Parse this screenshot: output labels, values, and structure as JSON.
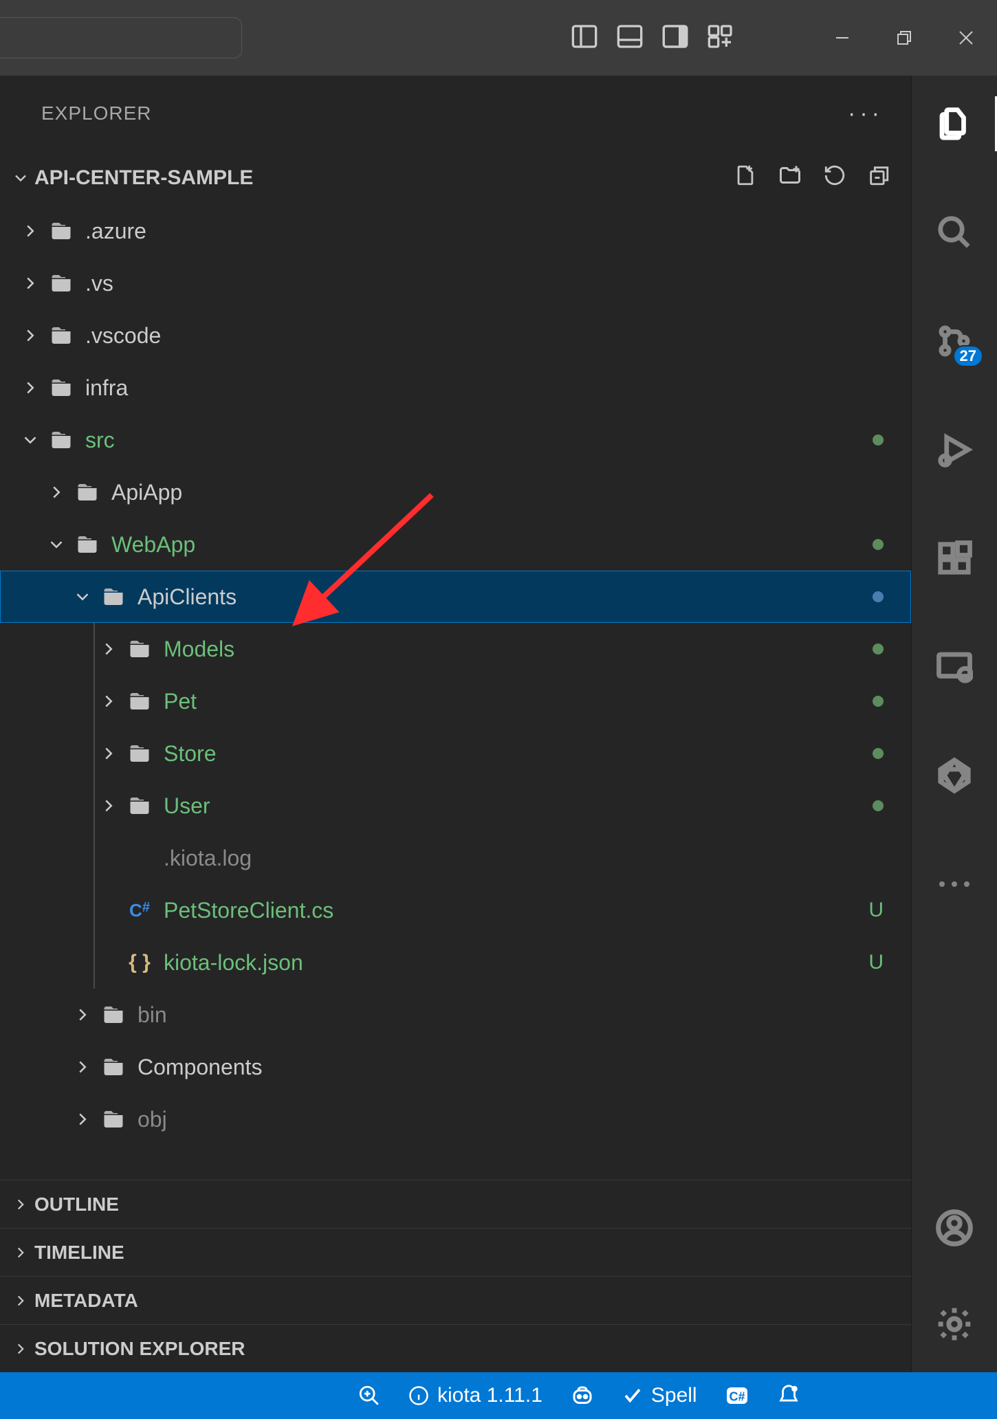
{
  "titlebar": {
    "search_placeholder": ""
  },
  "explorer": {
    "title": "EXPLORER",
    "workspace": "API-CENTER-SAMPLE"
  },
  "activitybar": {
    "scm_badge": "27"
  },
  "tree": {
    "items": [
      {
        "label": ".azure",
        "depth": 1,
        "kind": "folder",
        "expanded": false,
        "color": "def"
      },
      {
        "label": ".vs",
        "depth": 1,
        "kind": "folder",
        "expanded": false,
        "color": "def"
      },
      {
        "label": ".vscode",
        "depth": 1,
        "kind": "folder",
        "expanded": false,
        "color": "def"
      },
      {
        "label": "infra",
        "depth": 1,
        "kind": "folder",
        "expanded": false,
        "color": "def"
      },
      {
        "label": "src",
        "depth": 1,
        "kind": "folder",
        "expanded": true,
        "color": "mod",
        "status": "dot-green"
      },
      {
        "label": "ApiApp",
        "depth": 2,
        "kind": "folder",
        "expanded": false,
        "color": "def"
      },
      {
        "label": "WebApp",
        "depth": 2,
        "kind": "folder",
        "expanded": true,
        "color": "mod",
        "status": "dot-green"
      },
      {
        "label": "ApiClients",
        "depth": 3,
        "kind": "folder",
        "expanded": true,
        "color": "def",
        "status": "dot-blue",
        "selected": true
      },
      {
        "label": "Models",
        "depth": 4,
        "kind": "folder",
        "expanded": false,
        "color": "mod",
        "status": "dot-green",
        "guide": true
      },
      {
        "label": "Pet",
        "depth": 4,
        "kind": "folder",
        "expanded": false,
        "color": "mod",
        "status": "dot-green",
        "guide": true
      },
      {
        "label": "Store",
        "depth": 4,
        "kind": "folder",
        "expanded": false,
        "color": "mod",
        "status": "dot-green",
        "guide": true
      },
      {
        "label": "User",
        "depth": 4,
        "kind": "folder",
        "expanded": false,
        "color": "mod",
        "status": "dot-green",
        "guide": true
      },
      {
        "label": ".kiota.log",
        "depth": 4,
        "kind": "file",
        "icon": "blank",
        "color": "muted",
        "guide": true
      },
      {
        "label": "PetStoreClient.cs",
        "depth": 4,
        "kind": "file",
        "icon": "cs",
        "color": "mod",
        "status": "U",
        "guide": true
      },
      {
        "label": "kiota-lock.json",
        "depth": 4,
        "kind": "file",
        "icon": "json",
        "color": "mod",
        "status": "U",
        "guide": true
      },
      {
        "label": "bin",
        "depth": 3,
        "kind": "folder",
        "expanded": false,
        "color": "muted"
      },
      {
        "label": "Components",
        "depth": 3,
        "kind": "folder",
        "expanded": false,
        "color": "def"
      },
      {
        "label": "obj",
        "depth": 3,
        "kind": "folder",
        "expanded": false,
        "color": "muted"
      }
    ]
  },
  "sections": {
    "outline": "OUTLINE",
    "timeline": "TIMELINE",
    "metadata": "METADATA",
    "solution": "SOLUTION EXPLORER"
  },
  "statusbar": {
    "kiota": "kiota 1.11.1",
    "spell": "Spell"
  },
  "annotation": {
    "arrow_color": "#ff2d2d"
  }
}
